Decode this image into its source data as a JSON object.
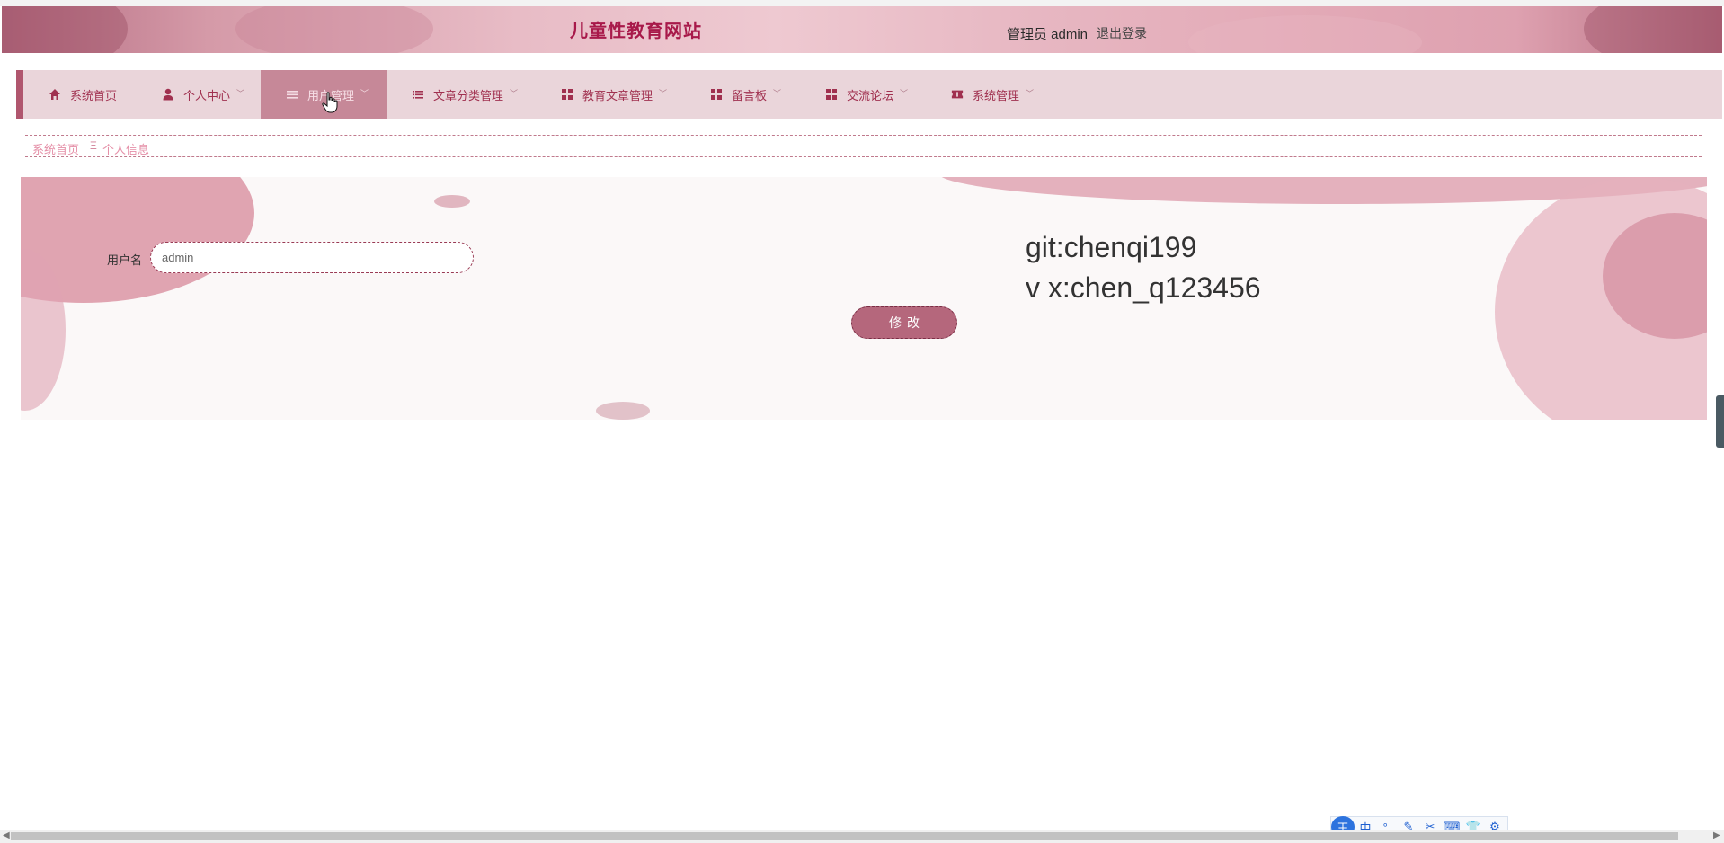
{
  "header": {
    "site_title": "儿童性教育网站",
    "admin_label": "管理员 admin",
    "logout_label": "退出登录"
  },
  "nav": {
    "items": [
      {
        "label": "系统首页",
        "icon": "home-icon",
        "has_dropdown": false
      },
      {
        "label": "个人中心",
        "icon": "user-icon",
        "has_dropdown": true
      },
      {
        "label": "用户管理",
        "icon": "list-icon",
        "has_dropdown": true,
        "active": true
      },
      {
        "label": "文章分类管理",
        "icon": "list-icon",
        "has_dropdown": true
      },
      {
        "label": "教育文章管理",
        "icon": "grid-icon",
        "has_dropdown": true
      },
      {
        "label": "留言板",
        "icon": "grid-icon",
        "has_dropdown": true
      },
      {
        "label": "交流论坛",
        "icon": "grid-icon",
        "has_dropdown": true
      },
      {
        "label": "系统管理",
        "icon": "ticket-icon",
        "has_dropdown": true
      }
    ]
  },
  "breadcrumb": {
    "home": "系统首页",
    "separator": "Ξ",
    "current": "个人信息"
  },
  "form": {
    "username_label": "用户名",
    "username_value": "admin",
    "submit_label": "修改"
  },
  "contact": {
    "line1": "git:chenqi199",
    "line2": "v x:chen_q123456"
  },
  "ime": {
    "logo": "王",
    "mode": "中"
  },
  "colors": {
    "accent": "#a8194a",
    "nav_bg": "#ead5da",
    "nav_active": "#c68898",
    "button": "#b5677c"
  }
}
